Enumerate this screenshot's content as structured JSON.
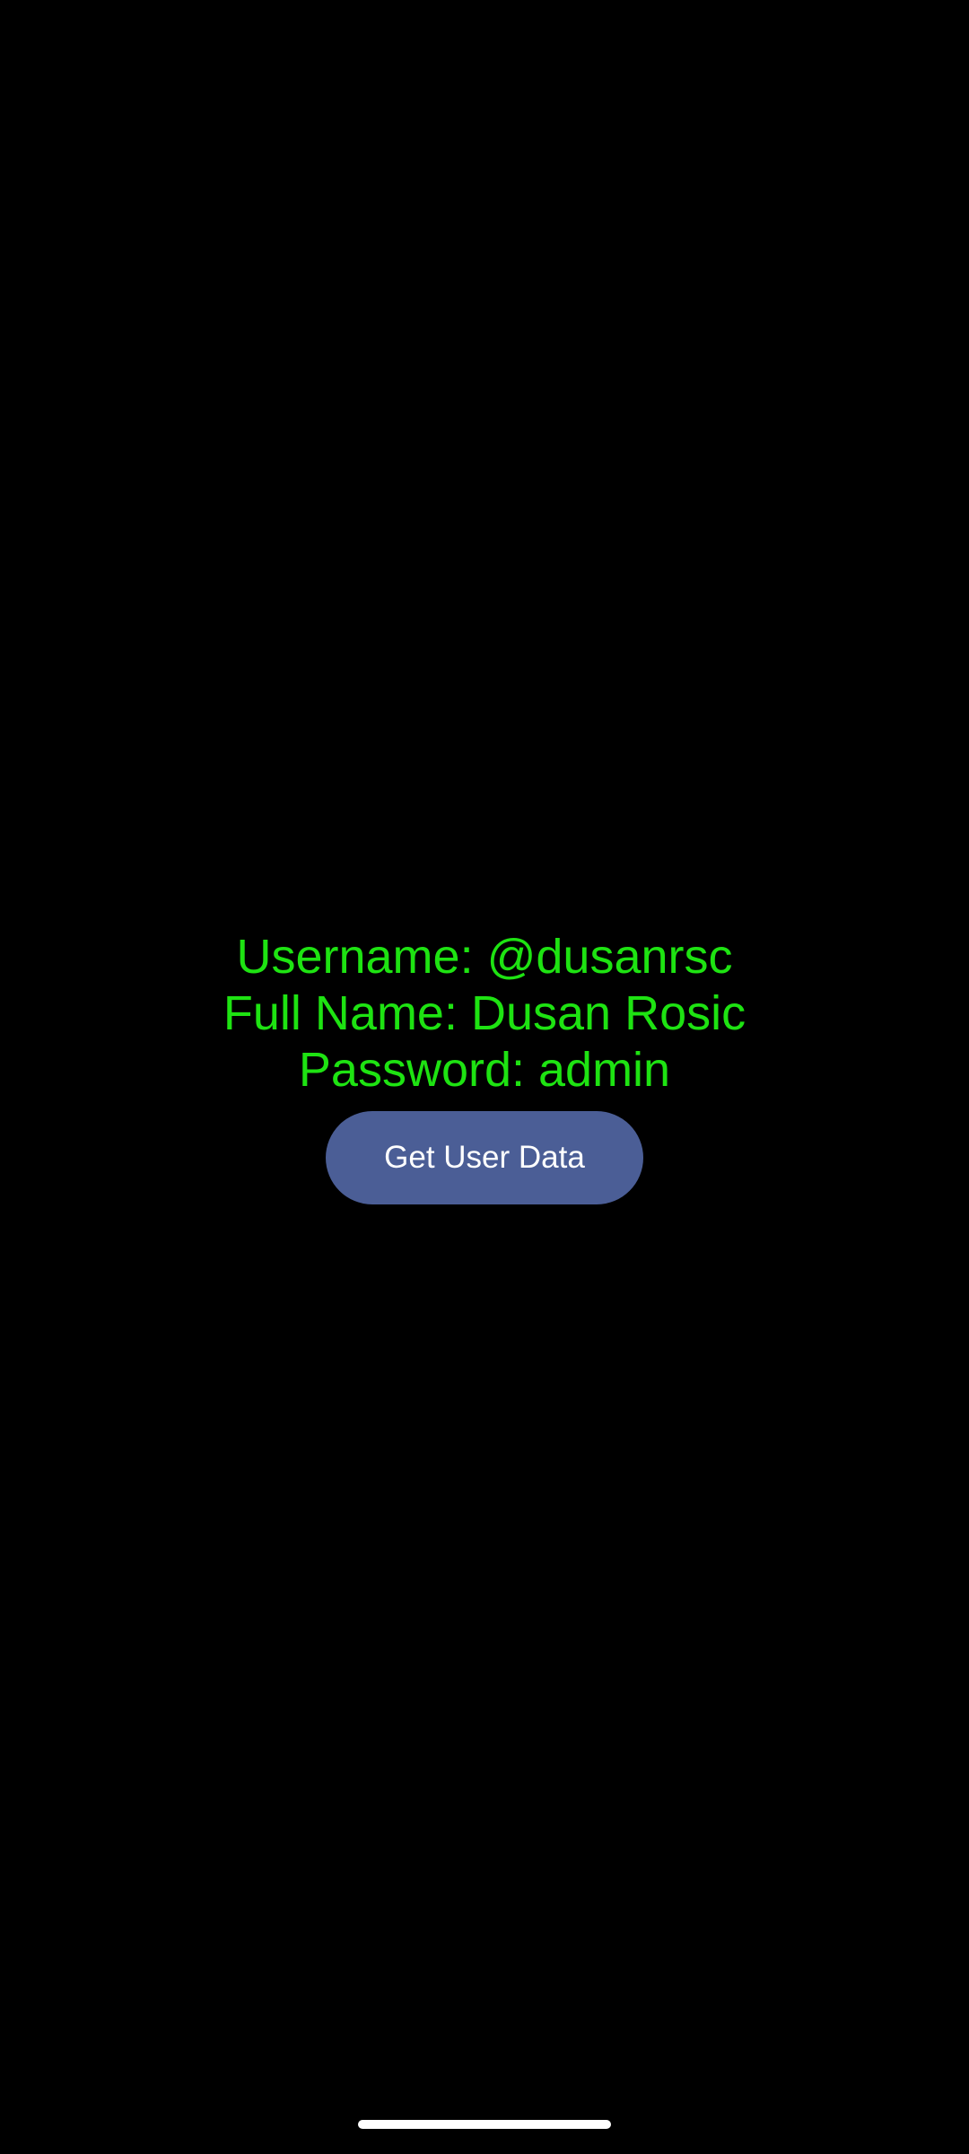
{
  "user_info": {
    "username_line": "Username: @dusanrsc",
    "fullname_line": "Full Name: Dusan Rosic",
    "password_line": "Password: admin"
  },
  "actions": {
    "get_user_data_label": "Get User Data"
  },
  "colors": {
    "background": "#000000",
    "info_text": "#1ee312",
    "button_bg": "#4b5e96",
    "button_text": "#ffffff"
  }
}
